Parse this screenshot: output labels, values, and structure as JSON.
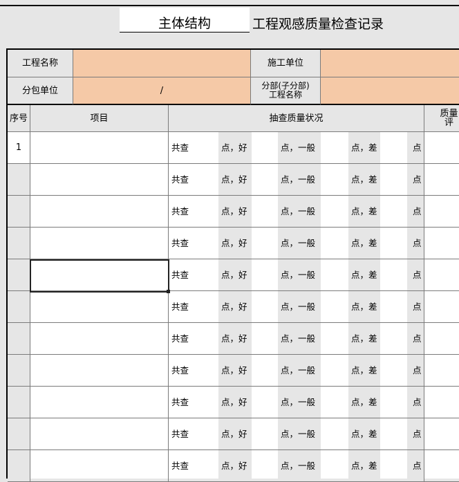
{
  "title": {
    "left": "主体结构",
    "right": "工程观感质量检查记录"
  },
  "info": {
    "project_name_label": "工程名称",
    "project_name_value": "",
    "contractor_label": "施工单位",
    "contractor_value": "",
    "subcontractor_label": "分包单位",
    "subcontractor_value": "/",
    "subsection_label_line1": "分部(子分部)",
    "subsection_label_line2": "工程名称",
    "subsection_value": ""
  },
  "header": {
    "seq": "序号",
    "item": "项目",
    "status": "抽查质量状况",
    "quality": "质量评"
  },
  "row_text": {
    "total": "共查",
    "good": "点，好",
    "ok": "点，一般",
    "bad": "点，差",
    "end": "点"
  },
  "rows": [
    {
      "seq": "1",
      "item": ""
    },
    {
      "seq": "",
      "item": ""
    },
    {
      "seq": "",
      "item": ""
    },
    {
      "seq": "",
      "item": ""
    },
    {
      "seq": "",
      "item": ""
    },
    {
      "seq": "",
      "item": ""
    },
    {
      "seq": "",
      "item": ""
    },
    {
      "seq": "",
      "item": ""
    },
    {
      "seq": "",
      "item": ""
    },
    {
      "seq": "",
      "item": ""
    },
    {
      "seq": "",
      "item": ""
    }
  ],
  "colors": {
    "peach": "#f5c9a7",
    "grey": "#e6e6e6"
  }
}
